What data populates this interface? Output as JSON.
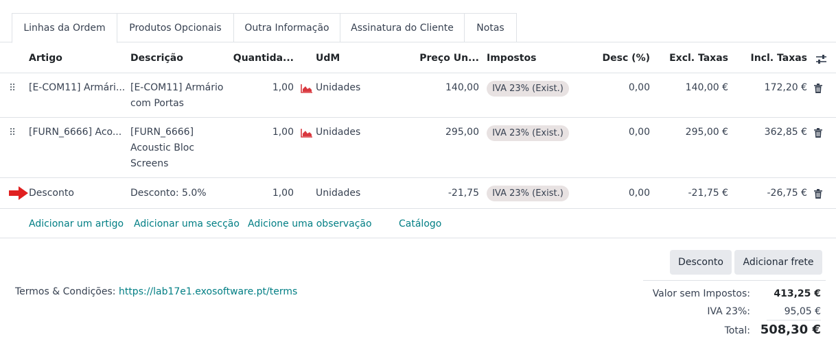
{
  "tabs": [
    "Linhas da Ordem",
    "Produtos Opcionais",
    "Outra Informação",
    "Assinatura do Cliente",
    "Notas"
  ],
  "headers": {
    "artigo": "Artigo",
    "descricao": "Descrição",
    "quantidade": "Quantida...",
    "udm": "UdM",
    "preco": "Preço Un...",
    "impostos": "Impostos",
    "desc": "Desc (%)",
    "excl": "Excl. Taxas",
    "incl": "Incl. Taxas"
  },
  "rows": [
    {
      "artigo": "[E-COM11] Armári...",
      "descricao": "[E-COM11] Armário com Portas",
      "quantidade": "1,00",
      "udm": "Unidades",
      "preco": "140,00",
      "imposto": "IVA 23% (Exist.)",
      "desc": "0,00",
      "excl": "140,00 €",
      "incl": "172,20 €"
    },
    {
      "artigo": "[FURN_6666] Aco...",
      "descricao": "[FURN_6666] Acoustic Bloc Screens",
      "quantidade": "1,00",
      "udm": "Unidades",
      "preco": "295,00",
      "imposto": "IVA 23% (Exist.)",
      "desc": "0,00",
      "excl": "295,00 €",
      "incl": "362,85 €"
    },
    {
      "artigo": "Desconto",
      "descricao": "Desconto: 5.0%",
      "quantidade": "1,00",
      "udm": "Unidades",
      "preco": "-21,75",
      "imposto": "IVA 23% (Exist.)",
      "desc": "0,00",
      "excl": "-21,75 €",
      "incl": "-26,75 €"
    }
  ],
  "add_links": {
    "artigo": "Adicionar um artigo",
    "seccao": "Adicionar uma secção",
    "observacao": "Adicione uma observação",
    "catalogo": "Catálogo"
  },
  "buttons": {
    "desconto": "Desconto",
    "frete": "Adicionar frete"
  },
  "terms": {
    "label": "Termos & Condições:",
    "url": "https://lab17e1.exosoftware.pt/terms"
  },
  "totals": {
    "sem_impostos_label": "Valor sem Impostos:",
    "sem_impostos_value": "413,25 €",
    "iva_label": "IVA 23%:",
    "iva_value": "95,05 €",
    "total_label": "Total:",
    "total_value": "508,30 €"
  },
  "colors": {
    "link": "#017e84",
    "badge": "#e8e2e2",
    "forecast_icon": "#d9383f",
    "arrow": "#e02020"
  },
  "icons": [
    "drag-handle-icon",
    "forecast-chart-icon",
    "trash-icon",
    "optional-columns-icon",
    "red-arrow-icon"
  ]
}
